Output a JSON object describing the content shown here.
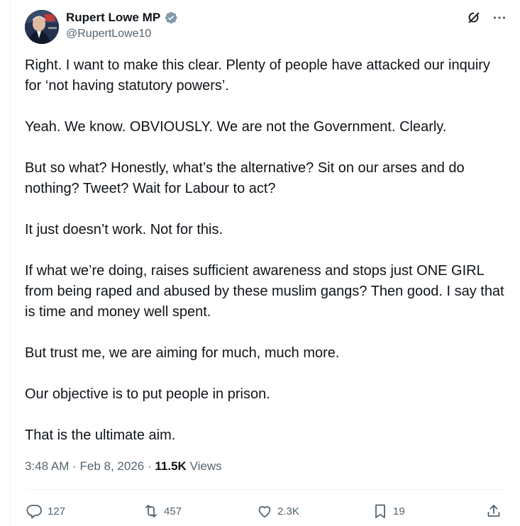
{
  "author": {
    "display_name": "Rupert Lowe MP",
    "handle": "@RupertLowe10",
    "avatar_icon": "avatar-photo",
    "verified_icon": "verified-badge-icon"
  },
  "header_icons": [
    "grok-icon",
    "more-icon"
  ],
  "tweet": {
    "paragraphs": [
      "Right. I want to make this clear. Plenty of people have attacked our inquiry for ‘not having statutory powers’.",
      "Yeah. We know. OBVIOUSLY. We are not the Government. Clearly.",
      "But so what? Honestly, what’s the alternative? Sit on our arses and do nothing? Tweet? Wait for Labour to act?",
      "It just doesn’t work. Not for this.",
      "If what we’re doing, raises sufficient awareness and stops just ONE GIRL from being raped and abused by these muslim gangs? Then good. I say that is time and money well spent.",
      "But trust me, we are aiming for much, much more.",
      "Our objective is to put people in prison.",
      "That is the ultimate aim."
    ]
  },
  "meta": {
    "time": "3:48 AM",
    "separator": "·",
    "date": "Feb 8, 2026",
    "views_count": "11.5K",
    "views_label": "Views"
  },
  "actions": {
    "replies": "127",
    "reposts": "457",
    "likes": "2.3K",
    "bookmarks": "19"
  },
  "colors": {
    "text": "#0f1419",
    "secondary": "#536471",
    "verified": "#829aab",
    "border": "#eff3f4"
  }
}
